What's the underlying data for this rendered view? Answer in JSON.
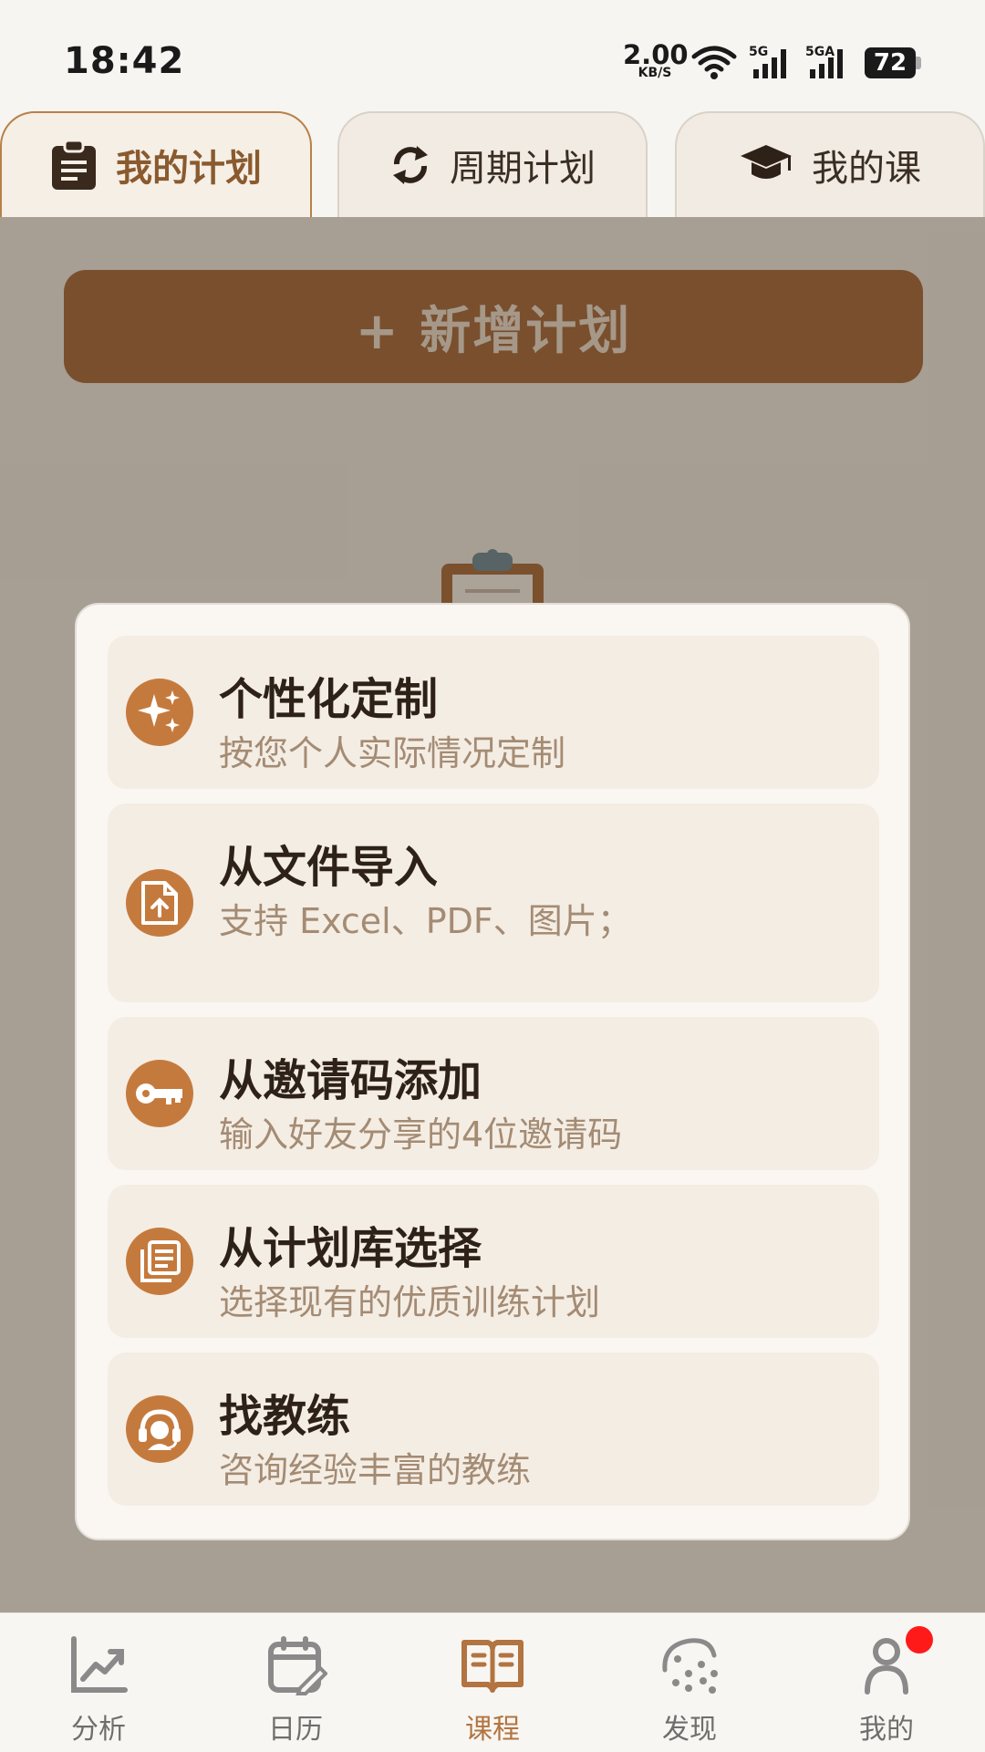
{
  "status_bar": {
    "time": "18:42",
    "network_speed": "2.00",
    "network_unit": "KB/S",
    "signal1_label": "5G",
    "signal2_label": "5GA",
    "battery": "72"
  },
  "tabs": [
    {
      "label": "我的计划",
      "icon": "clipboard-icon",
      "active": true
    },
    {
      "label": "周期计划",
      "icon": "refresh-icon",
      "active": false
    },
    {
      "label": "我的课",
      "icon": "graduation-cap-icon",
      "active": false
    }
  ],
  "main": {
    "add_plan_label": "+ 新增计划"
  },
  "menu": {
    "items": [
      {
        "title": "个性化定制",
        "subtitle": "按您个人实际情况定制",
        "icon": "sparkles-icon"
      },
      {
        "title": "从文件导入",
        "subtitle": "支持 Excel、PDF、图片；",
        "icon": "file-upload-icon"
      },
      {
        "title": "从邀请码添加",
        "subtitle": "输入好友分享的4位邀请码",
        "icon": "key-icon"
      },
      {
        "title": "从计划库选择",
        "subtitle": "选择现有的优质训练计划",
        "icon": "library-icon"
      },
      {
        "title": "找教练",
        "subtitle": "咨询经验丰富的教练",
        "icon": "headset-icon"
      }
    ]
  },
  "bottom_nav": [
    {
      "label": "分析",
      "icon": "chart-icon",
      "active": false
    },
    {
      "label": "日历",
      "icon": "calendar-icon",
      "active": false
    },
    {
      "label": "课程",
      "icon": "book-icon",
      "active": true
    },
    {
      "label": "发现",
      "icon": "discover-icon",
      "active": false
    },
    {
      "label": "我的",
      "icon": "person-icon",
      "active": false,
      "badge": true
    }
  ],
  "colors": {
    "accent": "#c57a3d",
    "active_tab_text": "#8a5a2e",
    "nav_active": "#b27440",
    "badge": "#ff1a1a"
  }
}
